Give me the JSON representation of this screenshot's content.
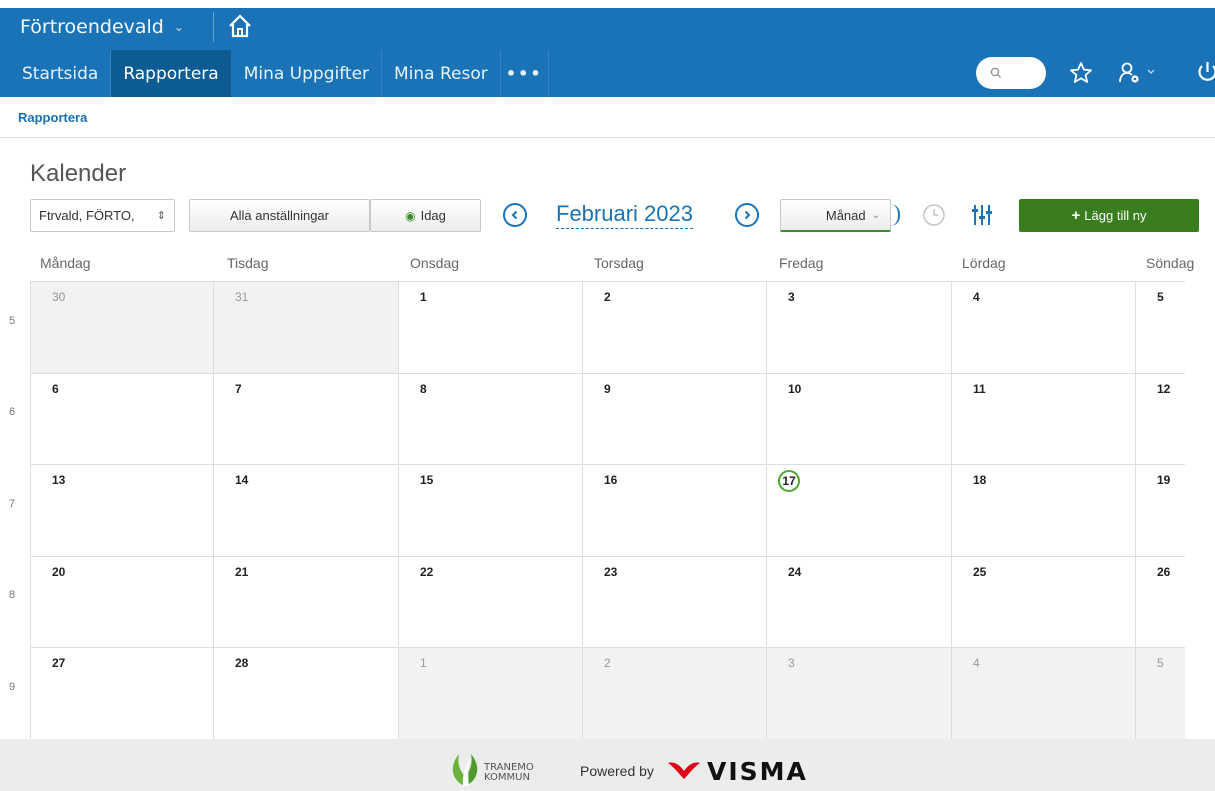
{
  "header": {
    "role": "Förtroendevald",
    "nav": [
      "Startsida",
      "Rapportera",
      "Mina Uppgifter",
      "Mina Resor"
    ],
    "more": "•••",
    "icons": {
      "home": "home-icon",
      "search": "search-icon",
      "star": "star-icon",
      "user_settings": "user-settings-icon",
      "power": "power-icon"
    }
  },
  "breadcrumb": "Rapportera",
  "page": {
    "title": "Kalender",
    "employee_select": "Ftrvald, FÖRTO,",
    "all_employments": "Alla anställningar",
    "today": "Idag",
    "month_label": "Februari 2023",
    "view_select": "Månad",
    "add_button": "Lägg till ny"
  },
  "calendar": {
    "weekdays": [
      "Måndag",
      "Tisdag",
      "Onsdag",
      "Torsdag",
      "Fredag",
      "Lördag",
      "Söndag"
    ],
    "weeks": [
      {
        "num": "5",
        "days": [
          {
            "d": "30",
            "out": true
          },
          {
            "d": "31",
            "out": true
          },
          {
            "d": "1"
          },
          {
            "d": "2"
          },
          {
            "d": "3"
          },
          {
            "d": "4"
          },
          {
            "d": "5"
          }
        ]
      },
      {
        "num": "6",
        "days": [
          {
            "d": "6"
          },
          {
            "d": "7"
          },
          {
            "d": "8"
          },
          {
            "d": "9"
          },
          {
            "d": "10"
          },
          {
            "d": "11"
          },
          {
            "d": "12"
          }
        ]
      },
      {
        "num": "7",
        "days": [
          {
            "d": "13"
          },
          {
            "d": "14"
          },
          {
            "d": "15"
          },
          {
            "d": "16"
          },
          {
            "d": "17",
            "today": true
          },
          {
            "d": "18"
          },
          {
            "d": "19"
          }
        ]
      },
      {
        "num": "8",
        "days": [
          {
            "d": "20"
          },
          {
            "d": "21"
          },
          {
            "d": "22"
          },
          {
            "d": "23"
          },
          {
            "d": "24"
          },
          {
            "d": "25"
          },
          {
            "d": "26"
          }
        ]
      },
      {
        "num": "9",
        "days": [
          {
            "d": "27"
          },
          {
            "d": "28"
          },
          {
            "d": "1",
            "out": true
          },
          {
            "d": "2",
            "out": true
          },
          {
            "d": "3",
            "out": true
          },
          {
            "d": "4",
            "out": true
          },
          {
            "d": "5",
            "out": true
          }
        ]
      }
    ]
  },
  "footer": {
    "org_line1": "TRANEMO",
    "org_line2": "KOMMUN",
    "powered_by": "Powered by",
    "brand": "VISMA"
  },
  "colors": {
    "accent": "#1a73b6",
    "today_ring": "#4caa2a",
    "add_button": "#3a7d1e"
  }
}
